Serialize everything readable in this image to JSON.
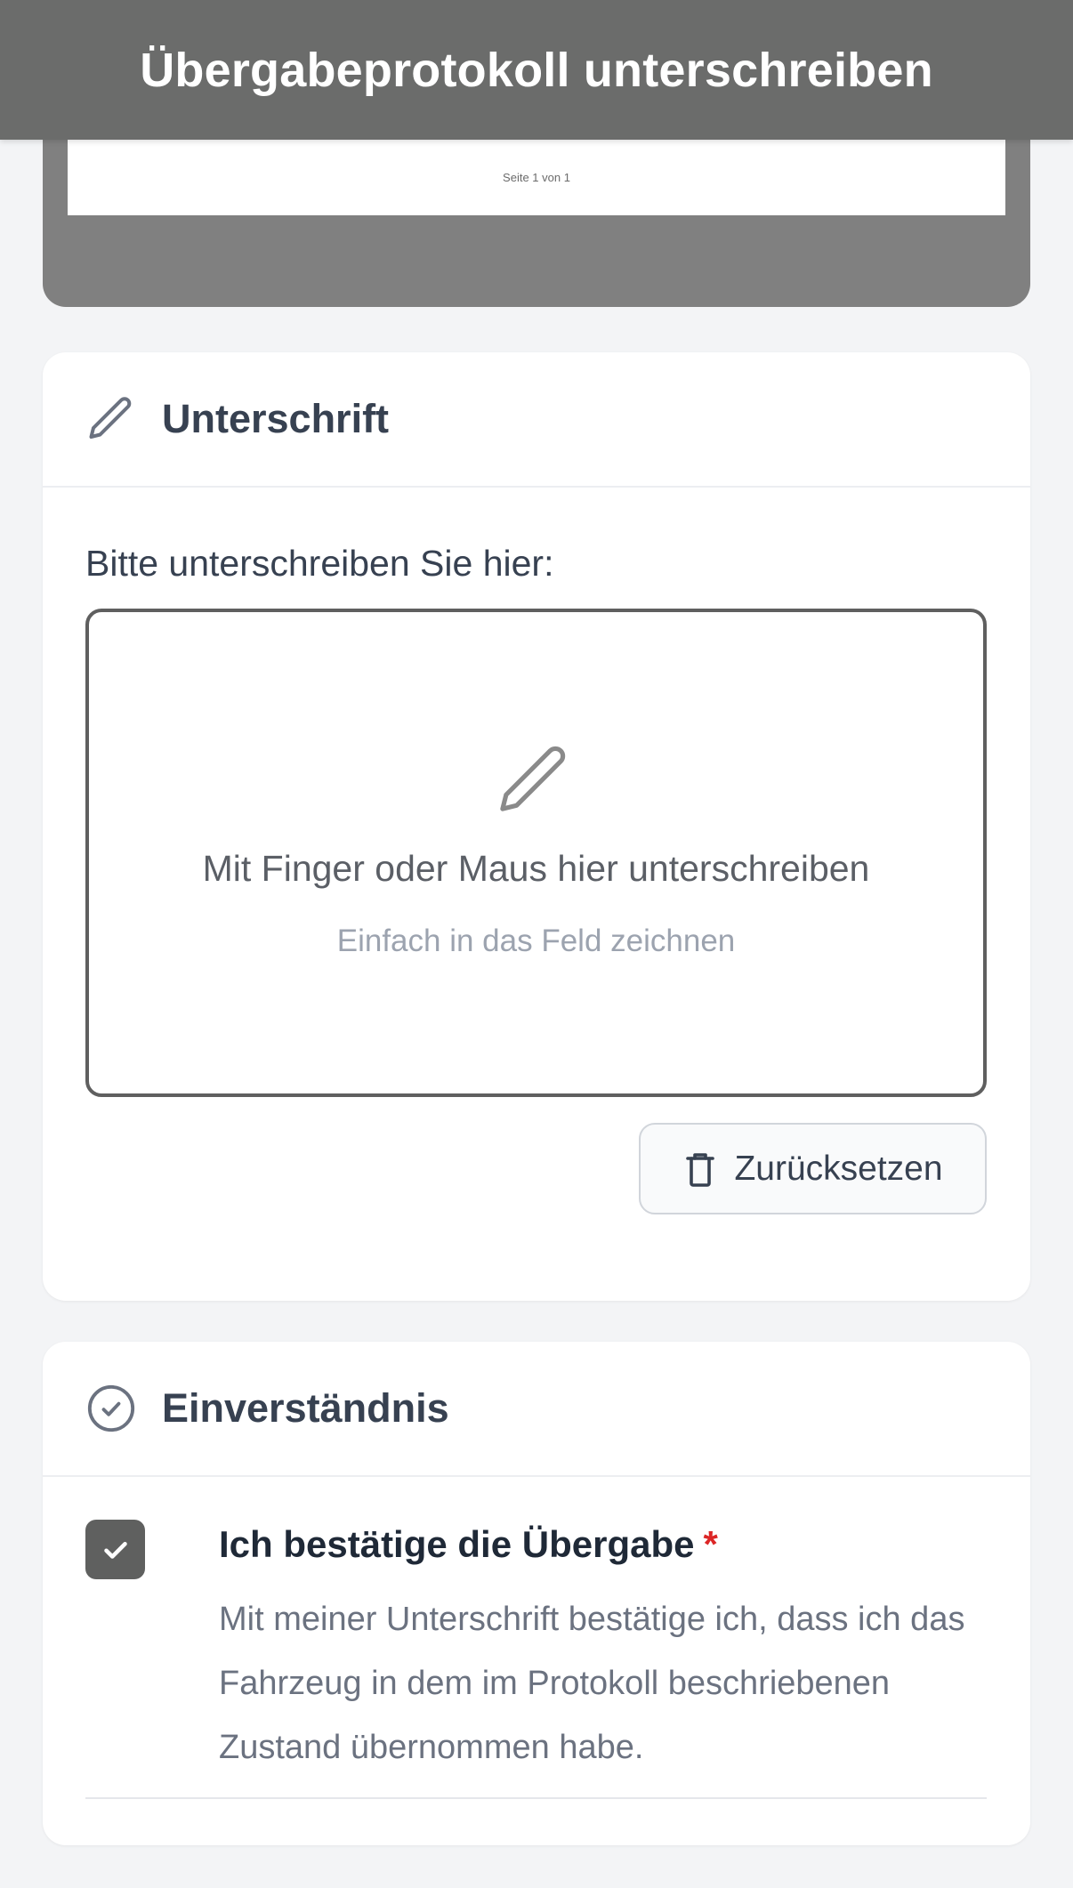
{
  "header": {
    "title": "Übergabeprotokoll unterschreiben"
  },
  "preview": {
    "page_label": "Seite 1 von 1"
  },
  "signature": {
    "title": "Unterschrift",
    "icon": "pencil-icon",
    "prompt": "Bitte unterschreiben Sie hier:",
    "pad_text": "Mit Finger oder Maus hier unterschreiben",
    "pad_hint": "Einfach in das Feld zeichnen",
    "reset_label": "Zurücksetzen"
  },
  "consent": {
    "title": "Einverständnis",
    "icon": "check-circle-icon",
    "checkbox_checked": true,
    "checkbox_label": "Ich bestätige die Übergabe",
    "required_marker": "*",
    "description": "Mit meiner Unterschrift bestätige ich, dass ich das Fahrzeug in dem im Protokoll beschriebenen Zustand übernommen habe."
  },
  "colors": {
    "header_bg": "#6b6c6b",
    "preview_bg": "#808080",
    "page_bg": "#f3f4f6",
    "checkbox_bg": "#5f605f",
    "required": "#dc2626"
  }
}
